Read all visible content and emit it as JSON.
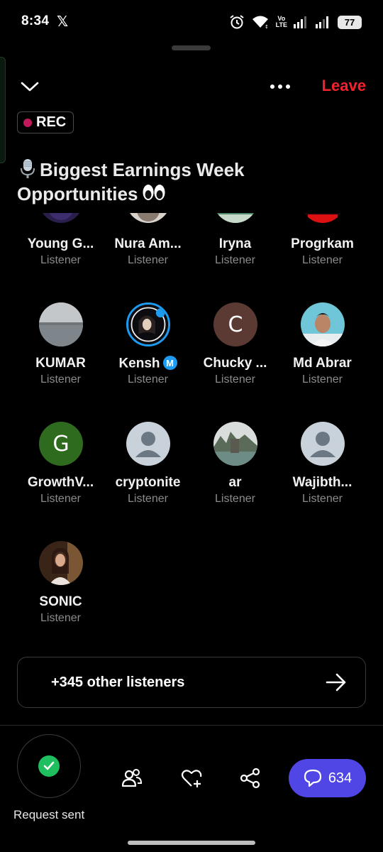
{
  "status_bar": {
    "time": "8:34",
    "app_icon": "x-logo",
    "alarm_icon": "alarm-icon",
    "wifi_icon": "wifi-icon",
    "network_label_top": "Vo",
    "network_label_bottom": "LTE",
    "battery": "77"
  },
  "header": {
    "collapse_icon": "chevron-down-icon",
    "more_icon": "more-icon",
    "leave_label": "Leave",
    "rec_label": "REC",
    "title": "Biggest Earnings Week Opportunities",
    "title_leading_emoji": "microphone",
    "title_trailing_emoji": "eyes"
  },
  "listeners": [
    {
      "name": "Young G...",
      "role": "Listener"
    },
    {
      "name": "Nura Am...",
      "role": "Listener"
    },
    {
      "name": "Iryna",
      "role": "Listener"
    },
    {
      "name": "Progrkam",
      "role": "Listener"
    },
    {
      "name": "KUMAR",
      "role": "Listener"
    },
    {
      "name": "Kensh",
      "role": "Listener",
      "badge": "M"
    },
    {
      "name": "Chucky ...",
      "role": "Listener",
      "initial": "C"
    },
    {
      "name": "Md Abrar",
      "role": "Listener"
    },
    {
      "name": "GrowthV...",
      "role": "Listener",
      "initial": "G"
    },
    {
      "name": "cryptonite",
      "role": "Listener"
    },
    {
      "name": "ar",
      "role": "Listener"
    },
    {
      "name": "Wajibth...",
      "role": "Listener"
    },
    {
      "name": "SONIC",
      "role": "Listener"
    }
  ],
  "others": {
    "label": "+345 other listeners",
    "arrow_icon": "arrow-right-icon"
  },
  "bottom_bar": {
    "request_label": "Request sent",
    "request_icon": "check-icon",
    "people_icon": "people-icon",
    "like_icon": "heart-plus-icon",
    "share_icon": "share-icon",
    "chat_icon": "chat-bubble-icon",
    "chat_count": "634"
  },
  "colors": {
    "background": "#000000",
    "leave": "#f4212e",
    "rec_dot": "#c2185b",
    "chat_button": "#4f46e5",
    "request_check": "#1fbf5f",
    "secondary_text": "#8b8b8b"
  }
}
